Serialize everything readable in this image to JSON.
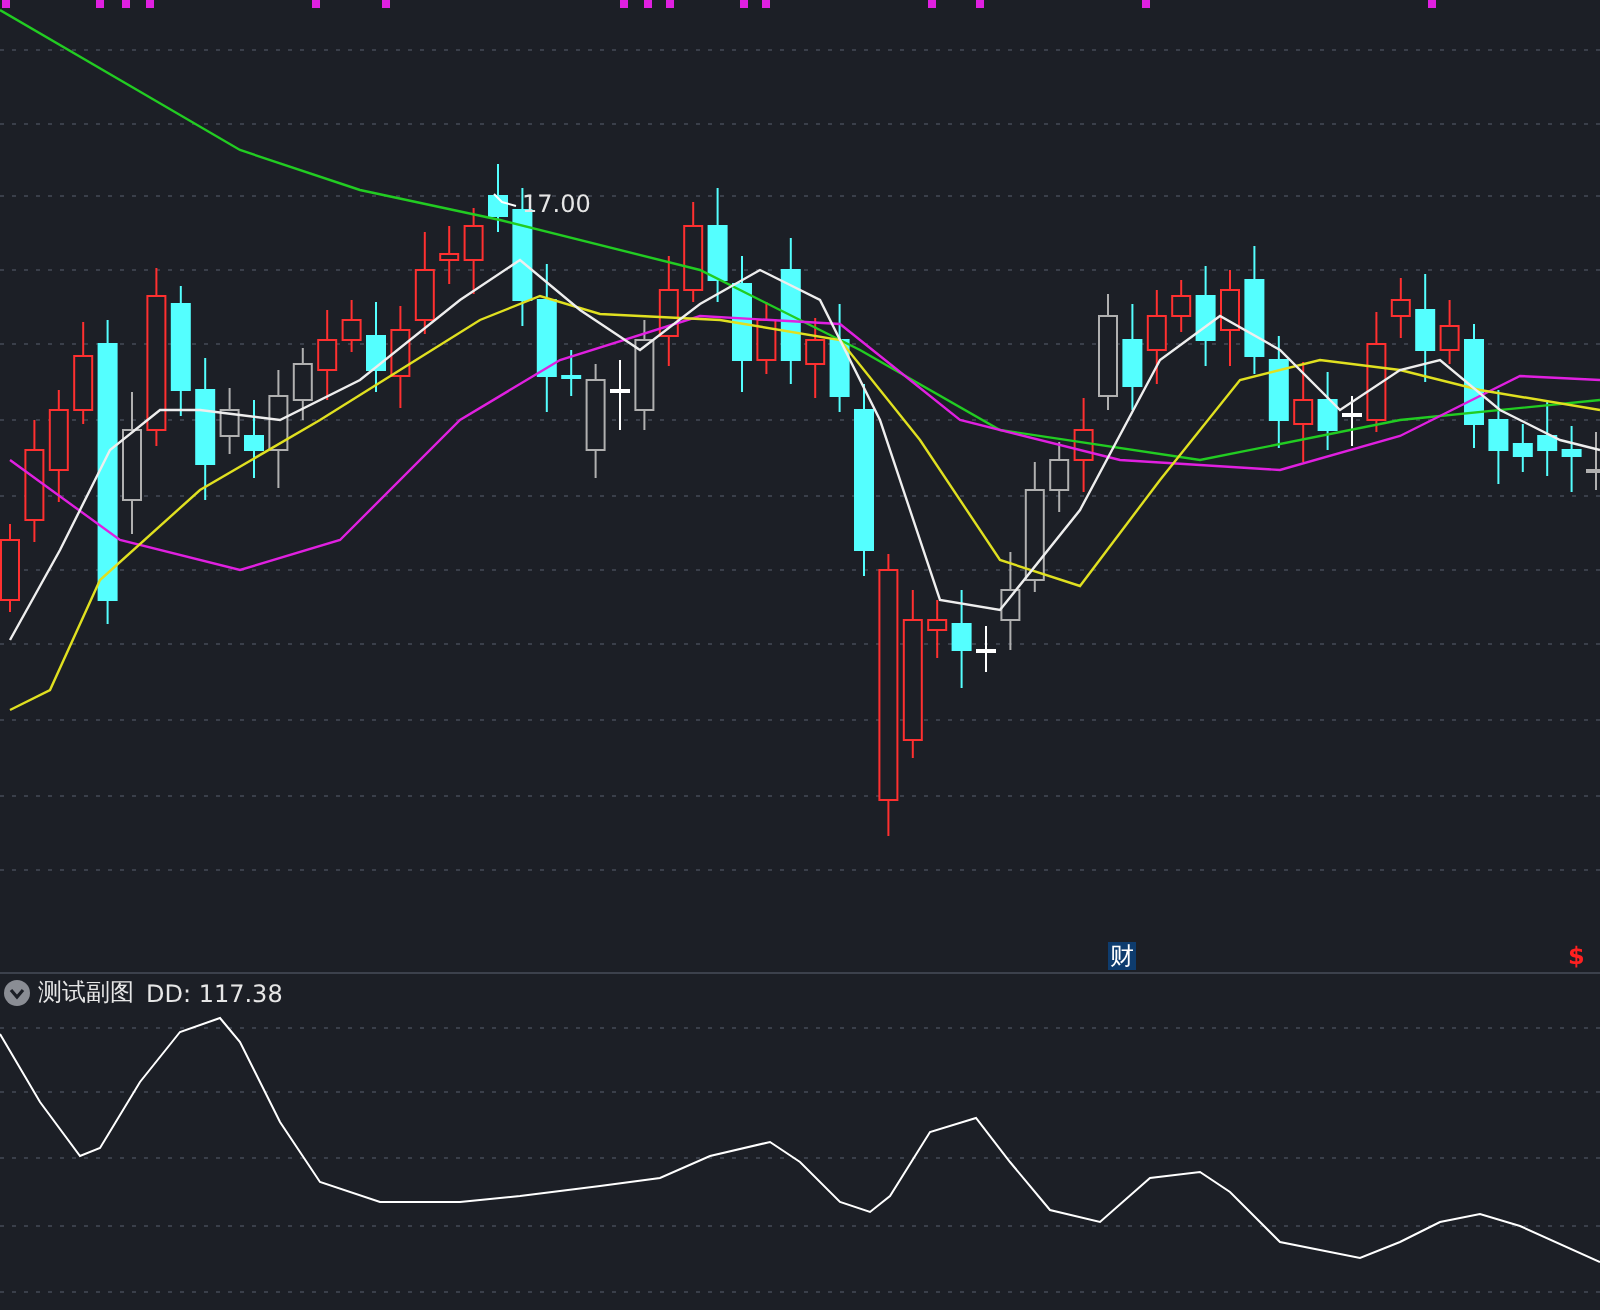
{
  "main_chart": {
    "price_label": "17.00",
    "finance_marker": "财",
    "dividend_marker": "$"
  },
  "sub_chart": {
    "title": "测试副图",
    "indicator": "DD: 117.38",
    "collapsed": false
  }
}
